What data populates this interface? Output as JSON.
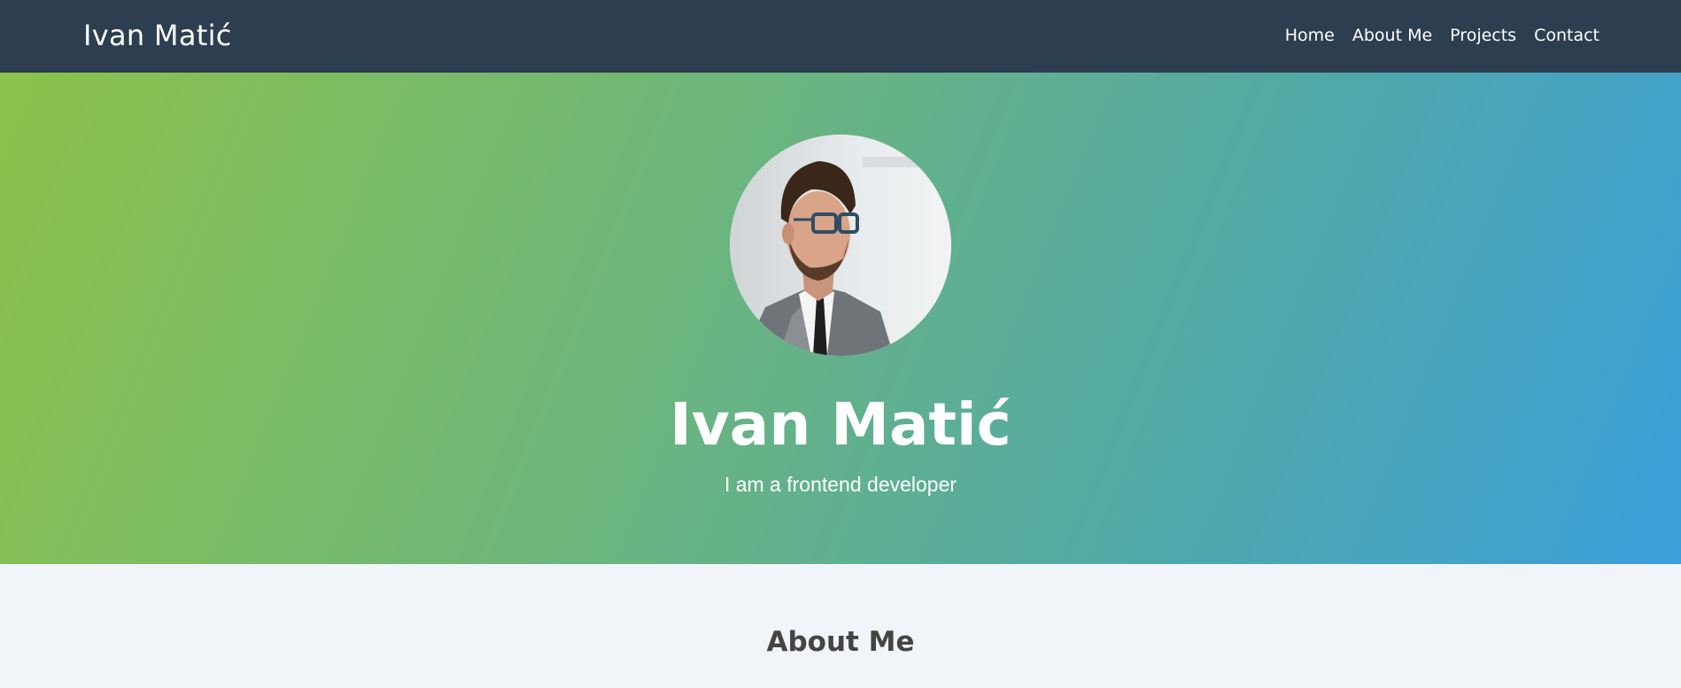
{
  "navbar": {
    "brand": "Ivan Matić",
    "links": [
      "Home",
      "About Me",
      "Projects",
      "Contact"
    ]
  },
  "hero": {
    "avatar_alt": "Portrait photo",
    "name": "Ivan Matić",
    "tagline": "I am a frontend developer",
    "gradient_colors": [
      "#8cc24a",
      "#3a9fdb"
    ]
  },
  "about": {
    "title": "About Me"
  },
  "colors": {
    "navbar_bg": "#2d3e51",
    "section_bg": "#f1f4f8",
    "heading_text": "#444444"
  }
}
